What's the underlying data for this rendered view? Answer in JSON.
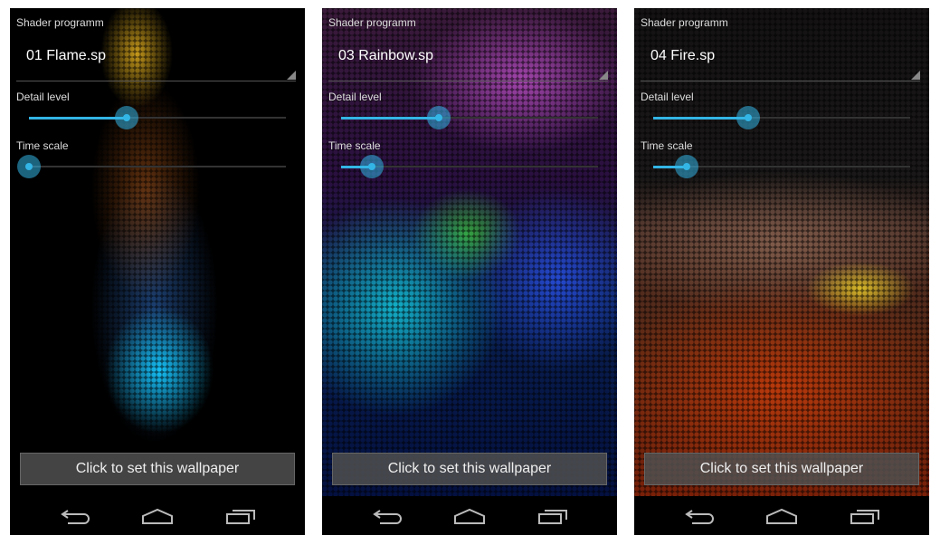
{
  "screens": [
    {
      "label_program": "Shader programm",
      "program": "01 Flame.sp",
      "label_detail": "Detail level",
      "detail_level": 0.38,
      "label_time": "Time scale",
      "time_scale": 0.0,
      "button": "Click to set this wallpaper",
      "theme": "flame"
    },
    {
      "label_program": "Shader programm",
      "program": "03 Rainbow.sp",
      "label_detail": "Detail level",
      "detail_level": 0.38,
      "label_time": "Time scale",
      "time_scale": 0.12,
      "button": "Click to set this wallpaper",
      "theme": "rainbow"
    },
    {
      "label_program": "Shader programm",
      "program": "04 Fire.sp",
      "label_detail": "Detail level",
      "detail_level": 0.37,
      "label_time": "Time scale",
      "time_scale": 0.13,
      "button": "Click to set this wallpaper",
      "theme": "fire"
    }
  ],
  "colors": {
    "accent": "#33b5e5"
  },
  "nav_icons": [
    "back-icon",
    "home-icon",
    "recent-apps-icon"
  ]
}
